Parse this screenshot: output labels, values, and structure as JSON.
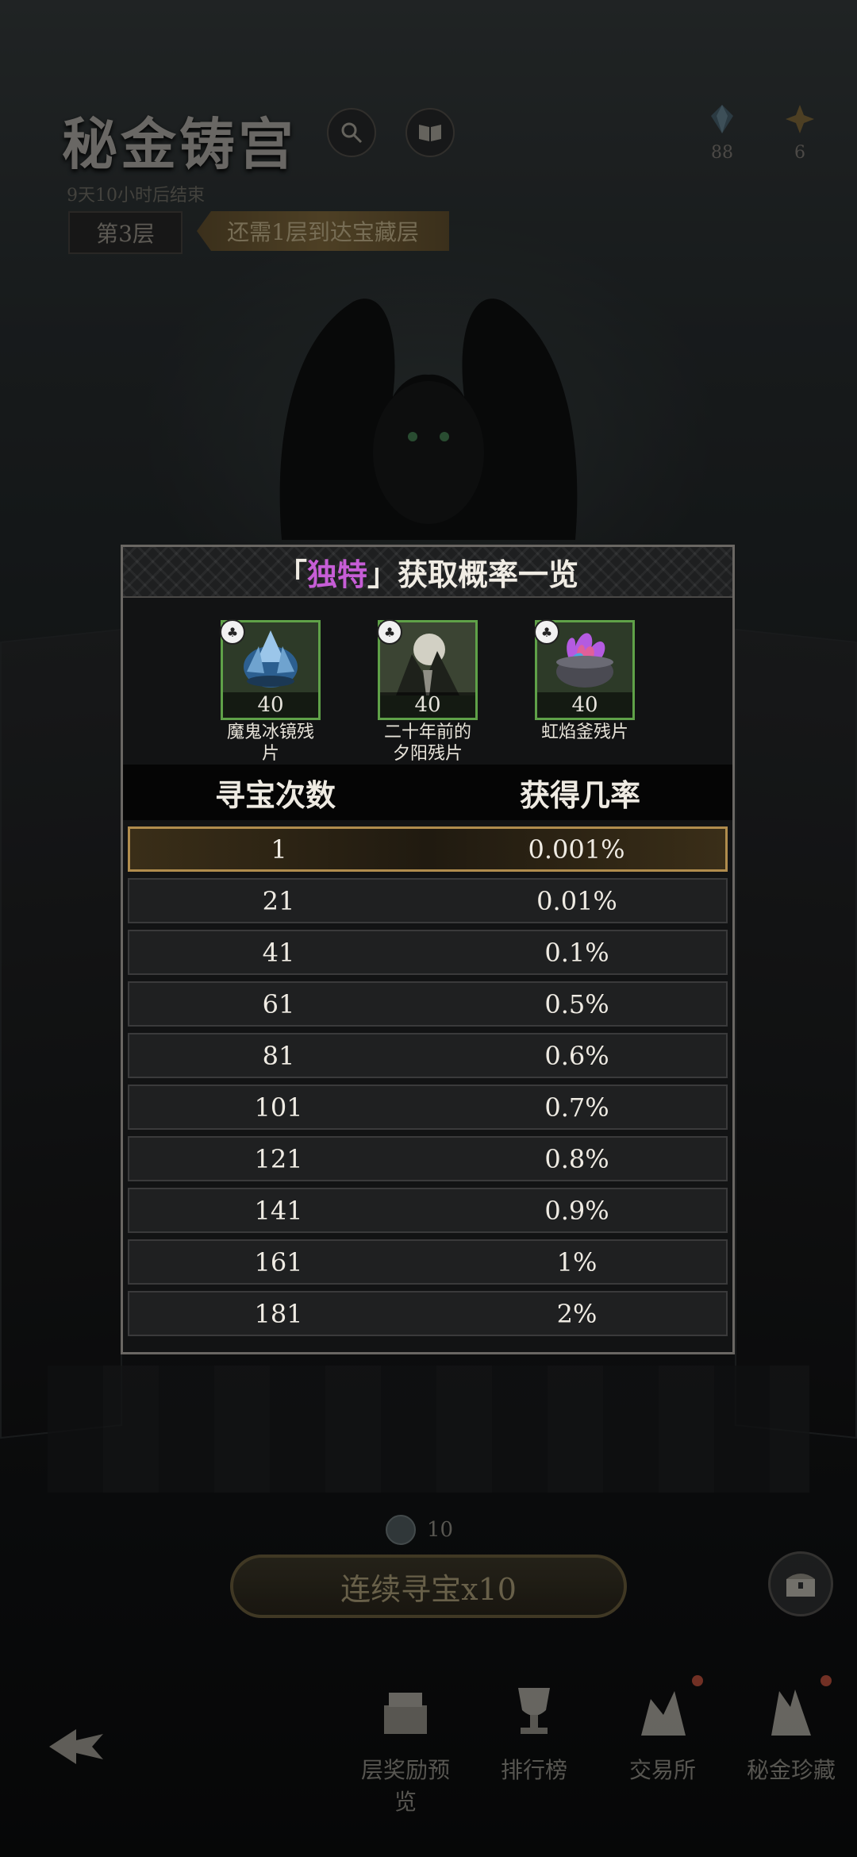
{
  "header": {
    "title": "秘金铸宫",
    "subtitle": "9天10小时后结束",
    "floor": "第3层",
    "banner": "还需1层到达宝藏层",
    "resources": [
      {
        "icon": "blue-gem-icon",
        "count": "88"
      },
      {
        "icon": "gold-star-icon",
        "count": "6"
      }
    ]
  },
  "dialog": {
    "title_open": "「",
    "title_highlight": "独特",
    "title_close": "」",
    "title_rest": "获取概率一览",
    "items": [
      {
        "name": "魔鬼冰镜残片",
        "count": "40",
        "icon": "ice-mirror-fragment-icon"
      },
      {
        "name": "二十年前的夕阳残片",
        "count": "40",
        "icon": "sunset-fragment-icon"
      },
      {
        "name": "虹焰釜残片",
        "count": "40",
        "icon": "rainbow-flame-cauldron-icon"
      }
    ],
    "columns": [
      "寻宝次数",
      "获得几率"
    ],
    "rows": [
      [
        "1",
        "0.001%"
      ],
      [
        "21",
        "0.01%"
      ],
      [
        "41",
        "0.1%"
      ],
      [
        "61",
        "0.5%"
      ],
      [
        "81",
        "0.6%"
      ],
      [
        "101",
        "0.7%"
      ],
      [
        "121",
        "0.8%"
      ],
      [
        "141",
        "0.9%"
      ],
      [
        "161",
        "1%"
      ],
      [
        "181",
        "2%"
      ]
    ]
  },
  "bottom": {
    "cost": "10",
    "main_button": "连续寻宝x10",
    "nav": [
      "层奖励预览",
      "排行榜",
      "交易所",
      "秘金珍藏"
    ]
  },
  "colors": {
    "highlight_purple": "#c65dd6",
    "item_frame_green": "#5fa148",
    "selected_row_gold": "#b08c4d"
  }
}
